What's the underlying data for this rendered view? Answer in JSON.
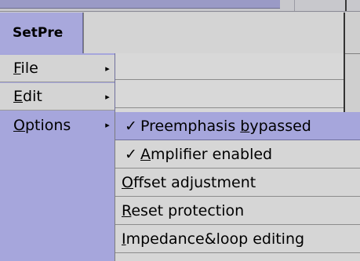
{
  "app_button": {
    "label": "SetPre"
  },
  "main_menu": {
    "items": [
      {
        "label": "File",
        "arrow": "▸"
      },
      {
        "label": "Edit",
        "arrow": "▸"
      },
      {
        "label": "Options",
        "arrow": "▸"
      }
    ]
  },
  "options_menu": {
    "items": [
      {
        "label": "Preemphasis bypassed",
        "check": "✓"
      },
      {
        "label": "Amplifier enabled",
        "check": "✓"
      },
      {
        "label": "Offset adjustment",
        "check": ""
      },
      {
        "label": "Reset protection",
        "check": ""
      },
      {
        "label": "Impedance&loop editing",
        "check": ""
      }
    ]
  },
  "colors": {
    "menu_highlight": "#a6a6dc",
    "menu_background": "#d4d4d4"
  }
}
